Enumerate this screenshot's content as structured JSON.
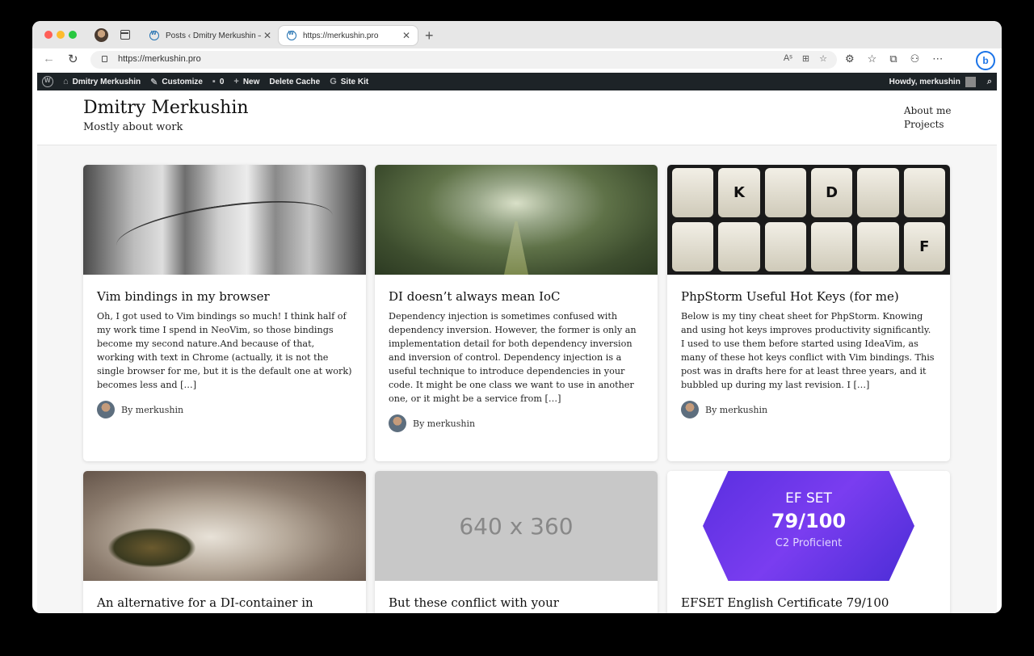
{
  "browser": {
    "tabs": [
      {
        "title": "Posts ‹ Dmitry Merkushin — W",
        "close": "✕"
      },
      {
        "title": "https://merkushin.pro",
        "close": "✕"
      }
    ],
    "new_tab": "+",
    "url": "https://merkushin.pro",
    "url_icons": [
      "Aˢ",
      "⊞",
      "☆"
    ],
    "toolbar_icons": [
      "⚙",
      "☆",
      "⧉",
      "⚇",
      "⋯"
    ],
    "bing": "b"
  },
  "adminbar": {
    "site": "Dmitry Merkushin",
    "customize": "Customize",
    "comments": "0",
    "new": "New",
    "delete_cache": "Delete Cache",
    "site_kit": "Site Kit",
    "howdy": "Howdy, merkushin"
  },
  "site": {
    "title": "Dmitry Merkushin",
    "tagline": "Mostly about work",
    "nav": [
      "About me",
      "Projects"
    ]
  },
  "posts": [
    {
      "title": "Vim bindings in my browser",
      "excerpt": "Oh, I got used to Vim bindings so much! I think half of my work time I spend in NeoVim, so those bindings become my second nature.And because of that, working with text in Chrome (actually, it is not the single browser for me, but it is the default one at work) becomes less and […]",
      "author": "By merkushin"
    },
    {
      "title": "DI doesn’t always mean IoC",
      "excerpt": "Dependency injection is sometimes confused with dependency inversion. However, the former is only an implementation detail for both dependency inversion and inversion of control. Dependency injection is a useful technique to introduce dependencies in your code. It might be one class we want to use in another one, or it might be a service from […]",
      "author": "By merkushin"
    },
    {
      "title": "PhpStorm Useful Hot Keys (for me)",
      "excerpt": "Below is my tiny cheat sheet for PhpStorm. Knowing and using hot keys improves productivity significantly. I used to use them before started using IdeaVim, as many of these hot keys conflict with Vim bindings. This post was in drafts here for at least three years, and it bubbled up during my last revision. I […]",
      "author": "By merkushin",
      "keys": [
        "",
        "K",
        "",
        "D",
        "",
        "",
        "",
        "",
        "",
        "",
        "",
        "F"
      ]
    },
    {
      "title": "An alternative for a DI-container in"
    },
    {
      "title": "But these conflict with your requirements",
      "placeholder": "640 x 360"
    },
    {
      "title": "EFSET English Certificate 79/100",
      "badge": [
        "EF SET",
        "79/100",
        "C2 Proficient"
      ]
    }
  ]
}
